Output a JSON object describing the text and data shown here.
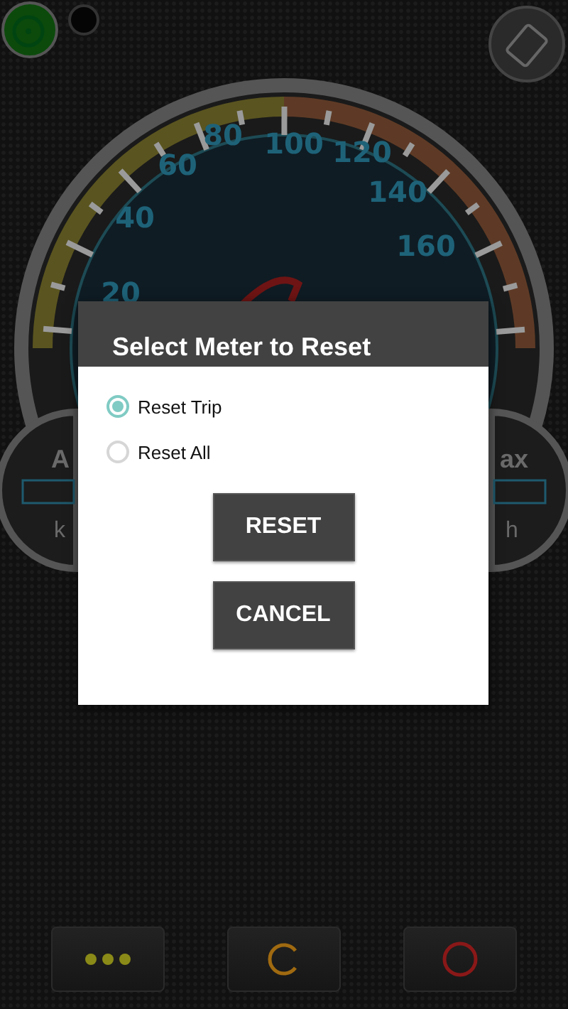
{
  "speedometer": {
    "scale_labels": [
      "20",
      "40",
      "60",
      "80",
      "100",
      "120",
      "140",
      "160"
    ]
  },
  "side_gauges": [
    {
      "label": "A",
      "unit": "k"
    },
    {
      "label": "ax",
      "unit": "h"
    }
  ],
  "dialog": {
    "title": "Select Meter to Reset",
    "options": [
      {
        "label": "Reset Trip",
        "selected": true
      },
      {
        "label": "Reset All",
        "selected": false
      }
    ],
    "buttons": [
      "RESET",
      "CANCEL"
    ]
  }
}
